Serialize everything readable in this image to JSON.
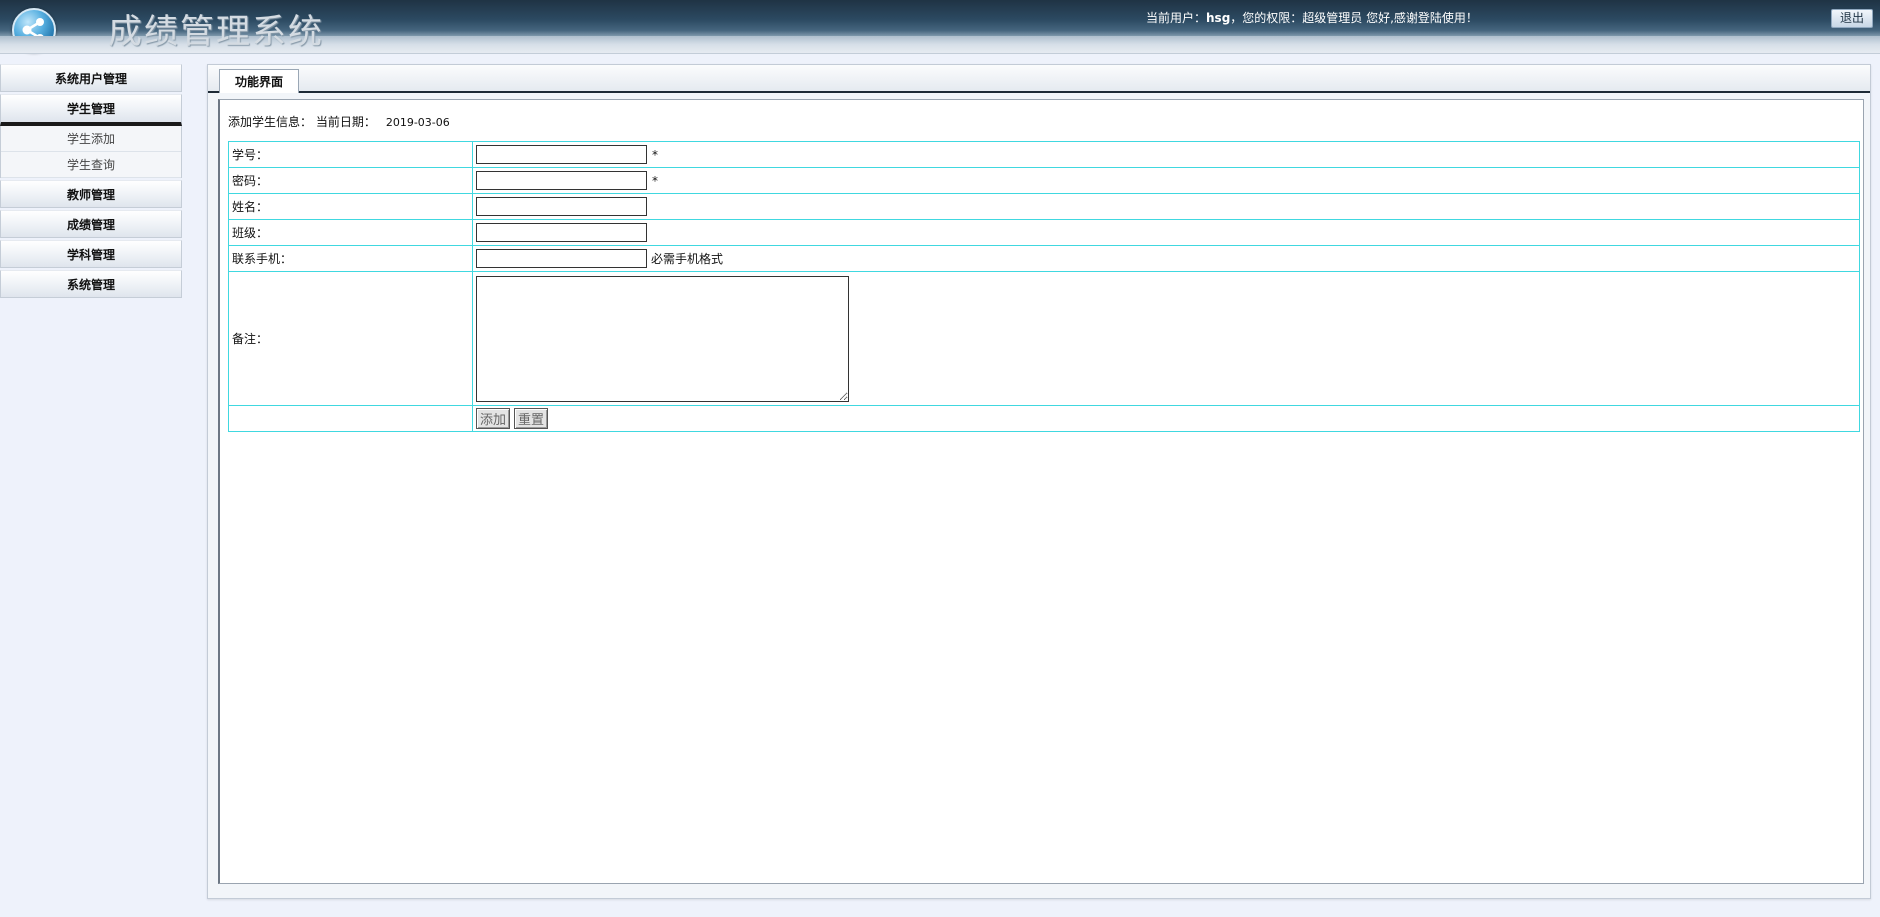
{
  "header": {
    "title": "成绩管理系统",
    "user_prefix": "当前用户：",
    "username": "hsg",
    "user_suffix": "，您的权限：超级管理员 您好,感谢登陆使用！",
    "logout_label": "退出"
  },
  "sidebar": {
    "menus": [
      {
        "label": "系统用户管理"
      },
      {
        "label": "学生管理",
        "submenu": [
          "学生添加",
          "学生查询"
        ]
      },
      {
        "label": "教师管理"
      },
      {
        "label": "成绩管理"
      },
      {
        "label": "学科管理"
      },
      {
        "label": "系统管理"
      }
    ]
  },
  "tab": {
    "label": "功能界面"
  },
  "form": {
    "heading": "添加学生信息：  当前日期：",
    "date": "2019-03-06",
    "fields": {
      "student_id": {
        "label": "学号：",
        "value": "",
        "required": "*"
      },
      "password": {
        "label": "密码：",
        "value": "",
        "required": "*"
      },
      "name": {
        "label": "姓名：",
        "value": ""
      },
      "class": {
        "label": "班级：",
        "value": ""
      },
      "phone": {
        "label": "联系手机：",
        "value": "",
        "hint": "必需手机格式"
      },
      "remark": {
        "label": "备注：",
        "value": ""
      }
    },
    "submit_label": "添加",
    "reset_label": "重置"
  }
}
